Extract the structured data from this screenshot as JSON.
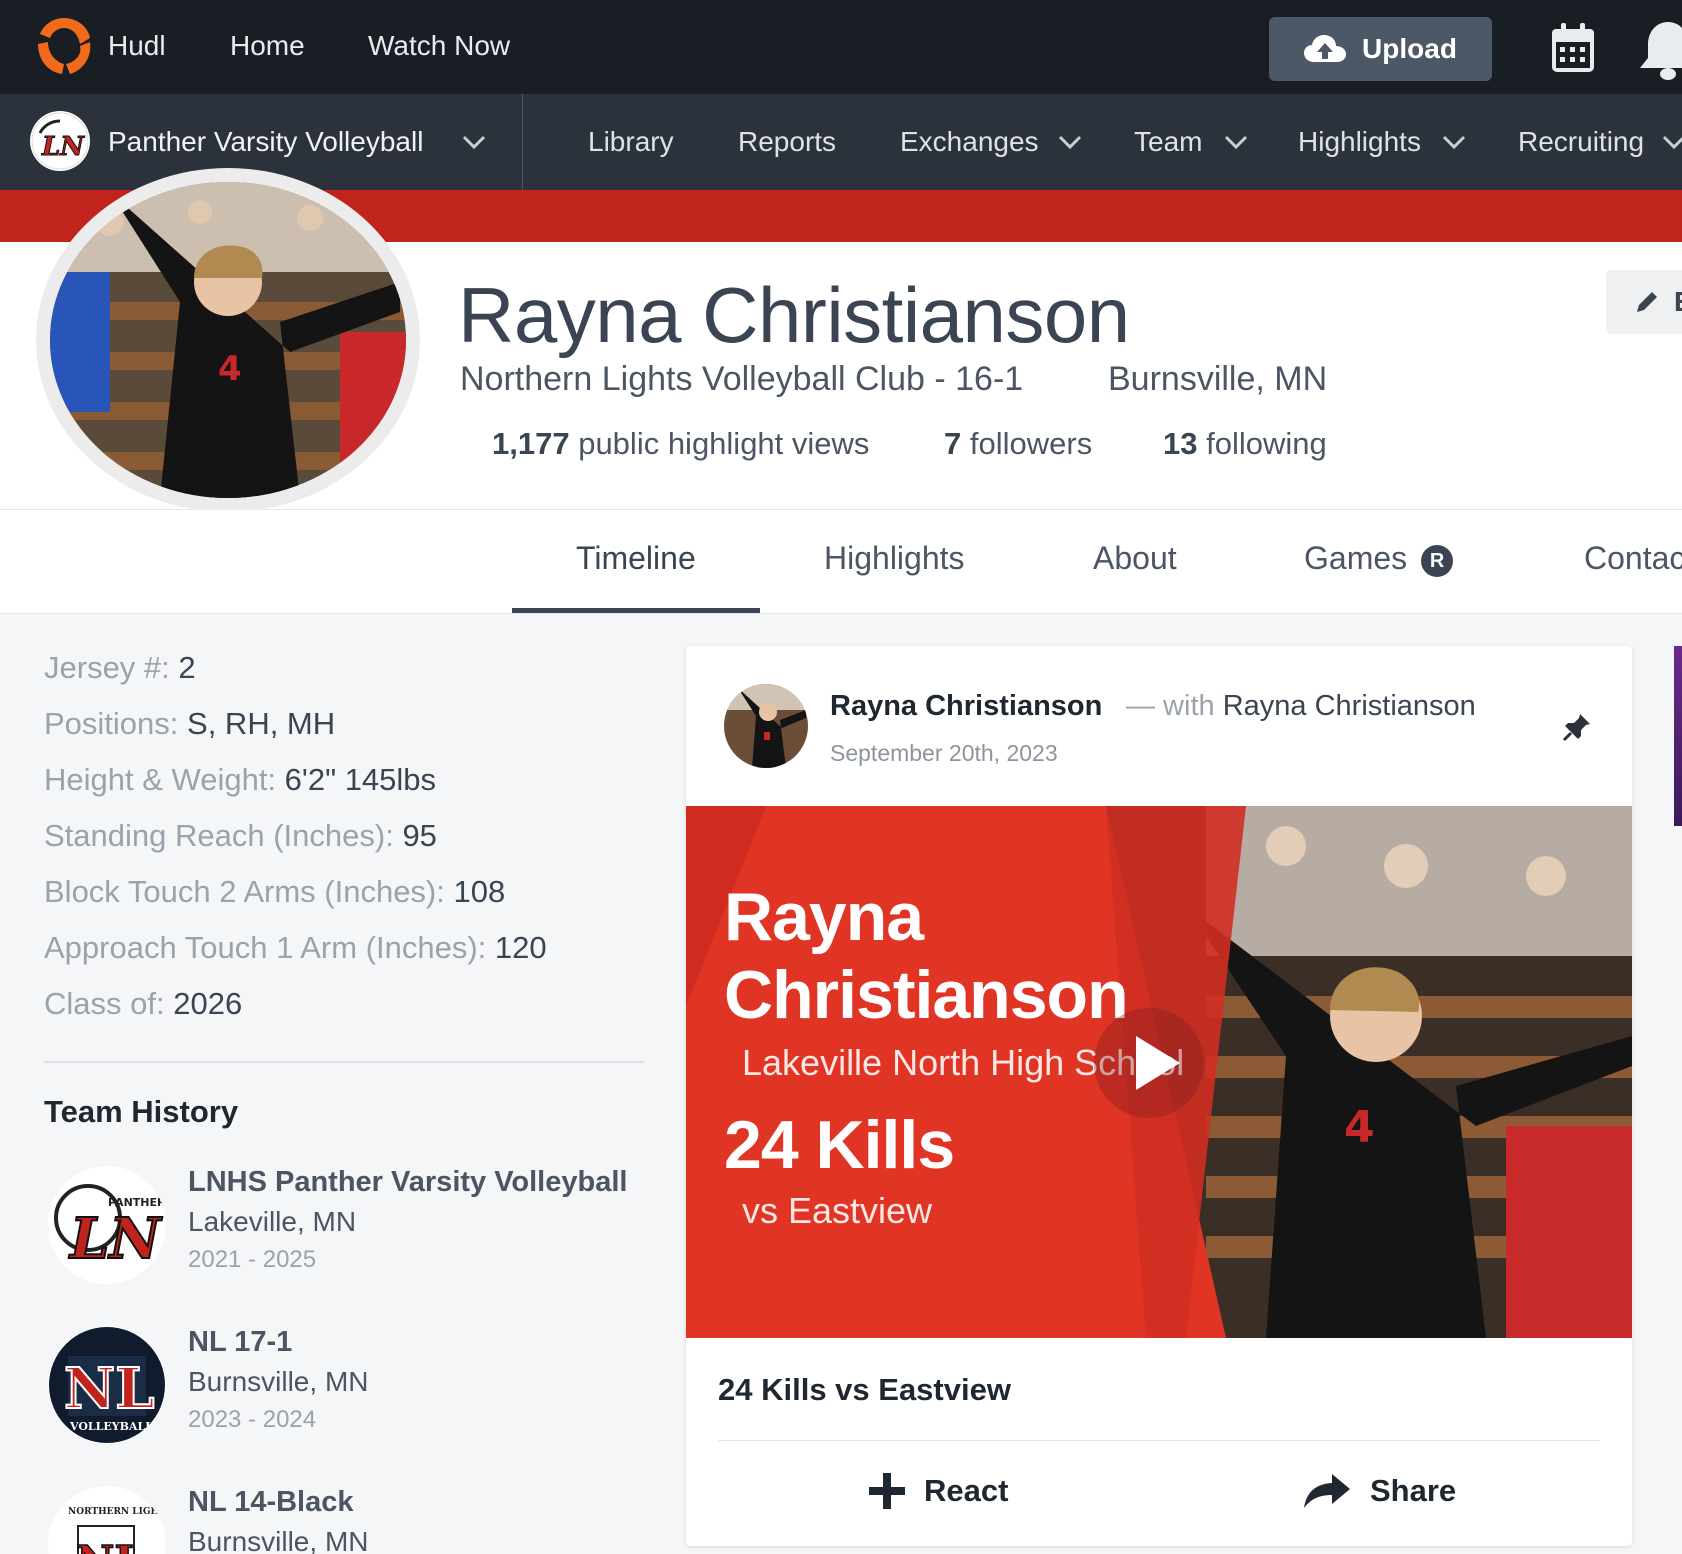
{
  "topbar": {
    "brand": "Hudl",
    "nav": [
      "Home",
      "Watch Now"
    ],
    "upload_label": "Upload"
  },
  "subnav": {
    "team_name": "Panther Varsity Volleyball",
    "items": [
      {
        "label": "Library",
        "dropdown": false
      },
      {
        "label": "Reports",
        "dropdown": false
      },
      {
        "label": "Exchanges",
        "dropdown": true
      },
      {
        "label": "Team",
        "dropdown": true
      },
      {
        "label": "Highlights",
        "dropdown": true
      },
      {
        "label": "Recruiting",
        "dropdown": true
      }
    ]
  },
  "profile": {
    "name": "Rayna Christianson",
    "team_record": "Northern Lights Volleyball Club - 16-1",
    "location": "Burnsville, MN",
    "stats": [
      {
        "value": "1,177",
        "label": "public highlight views"
      },
      {
        "value": "7",
        "label": "followers"
      },
      {
        "value": "13",
        "label": "following"
      }
    ],
    "edit_label": "E"
  },
  "tabs": {
    "items": [
      "Timeline",
      "Highlights",
      "About",
      "Games",
      "Contac"
    ],
    "active": "Timeline",
    "games_badge": "R"
  },
  "attributes": [
    {
      "label": "Jersey #:",
      "value": "2"
    },
    {
      "label": "Positions:",
      "value": "S, RH, MH"
    },
    {
      "label": "Height & Weight:",
      "value": "6'2\" 145lbs"
    },
    {
      "label": "Standing Reach (Inches):",
      "value": "95"
    },
    {
      "label": "Block Touch 2 Arms (Inches):",
      "value": "108"
    },
    {
      "label": "Approach Touch 1 Arm (Inches):",
      "value": "120"
    },
    {
      "label": "Class of:",
      "value": "2026"
    }
  ],
  "team_history": {
    "title": "Team History",
    "teams": [
      {
        "name": "LNHS Panther Varsity Volleyball",
        "location": "Lakeville, MN",
        "years": "2021 - 2025",
        "logo_text": "PANTHERS"
      },
      {
        "name": "NL 17-1",
        "location": "Burnsville, MN",
        "years": "2023 - 2024",
        "logo_text": "NL"
      },
      {
        "name": "NL 14-Black",
        "location": "Burnsville, MN",
        "years": "",
        "logo_text": "NORTHERN LIGHTS"
      }
    ],
    "logo_extra": {
      "ln": "LN",
      "volleyball": "VOLLEYBALL"
    }
  },
  "post": {
    "author": "Rayna Christianson",
    "with_prefix": "— with",
    "with_name": "Rayna Christianson",
    "date": "September 20th, 2023",
    "video": {
      "first_name": "Rayna",
      "last_name": "Christianson",
      "school": "Lakeville North High School",
      "stat": "24 Kills",
      "opponent": "vs Eastview",
      "jersey_number": "4"
    },
    "title": "24 Kills vs Eastview",
    "react_label": "React",
    "share_label": "Share"
  },
  "colors": {
    "topbar": "#191e25",
    "subbar": "#2b323b",
    "accent_red": "#c0241c",
    "video_red": "#e03424",
    "hudl_orange": "#f26a1b"
  }
}
